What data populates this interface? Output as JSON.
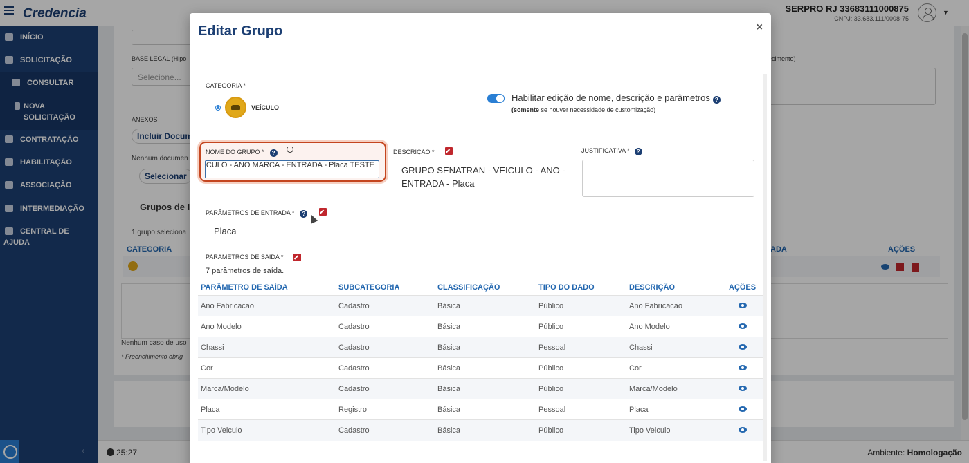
{
  "header": {
    "logo": "Credencia",
    "org_name": "SERPRO RJ 33683111000875",
    "org_cnpj": "CNPJ: 33.683.111/0008-75"
  },
  "sidebar": {
    "items": [
      {
        "label": "INÍCIO",
        "icon": "home-icon"
      },
      {
        "label": "SOLICITAÇÃO",
        "icon": "edit-icon"
      },
      {
        "label": "CONSULTAR",
        "icon": "search-icon"
      },
      {
        "label": "NOVA SOLICITAÇÃO",
        "icon": "file-icon"
      },
      {
        "label": "CONTRATAÇÃO",
        "icon": "handshake-icon"
      },
      {
        "label": "HABILITAÇÃO",
        "icon": "id-card-icon"
      },
      {
        "label": "ASSOCIAÇÃO",
        "icon": "users-icon"
      },
      {
        "label": "INTERMEDIAÇÃO",
        "icon": "user-tie-icon"
      },
      {
        "label": "CENTRAL DE AJUDA",
        "icon": "help-circle-icon"
      }
    ],
    "collapse_glyph": "‹"
  },
  "background_page": {
    "base_legal_label": "BASE LEGAL (Hipó",
    "base_legal_placeholder": "Selecione...",
    "right_label": "ecimento)",
    "anexos_label": "ANEXOS",
    "incluir_btn": "Incluir Docum",
    "nenhum_doc": "Nenhum documen",
    "selecionar_btn": "Selecionar",
    "grupos_title": "Grupos de In",
    "grupo_selecionado": "1 grupo seleciona",
    "col_categoria": "CATEGORIA",
    "col_ada": "ADA",
    "col_acoes": "AÇÕES",
    "nenhum_caso": "Nenhum caso de uso",
    "preenchimento": "* Preenchimento obrig"
  },
  "footer": {
    "timer": "25:27",
    "env_label": "Ambiente:",
    "env_value": "Homologação"
  },
  "modal": {
    "title": "Editar Grupo",
    "close": "×",
    "categoria_label": "CATEGORIA *",
    "categoria_option": "VEÍCULO",
    "toggle_text": "Habilitar edição de nome, descrição e parâmetros",
    "toggle_note_bold": "(somente",
    "toggle_note_rest": " se houver necessidade de customização)",
    "nome_label": "NOME DO GRUPO *",
    "nome_value": "GRUPO SENATRAN - VEICULO - ANO MARCA - ENTRADA - Placa  TESTE",
    "descricao_label": "DESCRIÇÃO *",
    "descricao_value": "GRUPO SENATRAN - VEICULO - ANO - ENTRADA - Placa",
    "justificativa_label": "JUSTIFICATIVA *",
    "param_entrada_label": "PARÂMETROS DE ENTRADA *",
    "param_entrada_value": "Placa",
    "param_saida_label": "PARÂMETROS DE SAÍDA *",
    "param_saida_count": "7 parâmetros de saída.",
    "table": {
      "headers": [
        "Parâmetro de saída",
        "Subcategoria",
        "Classificação",
        "Tipo do dado",
        "Descrição",
        "Ações"
      ],
      "rows": [
        [
          "Ano Fabricacao",
          "Cadastro",
          "Básica",
          "Público",
          "Ano Fabricacao"
        ],
        [
          "Ano Modelo",
          "Cadastro",
          "Básica",
          "Público",
          "Ano Modelo"
        ],
        [
          "Chassi",
          "Cadastro",
          "Básica",
          "Pessoal",
          "Chassi"
        ],
        [
          "Cor",
          "Cadastro",
          "Básica",
          "Público",
          "Cor"
        ],
        [
          "Marca/Modelo",
          "Cadastro",
          "Básica",
          "Público",
          "Marca/Modelo"
        ],
        [
          "Placa",
          "Registro",
          "Básica",
          "Pessoal",
          "Placa"
        ],
        [
          "Tipo Veiculo",
          "Cadastro",
          "Básica",
          "Público",
          "Tipo Veiculo"
        ]
      ]
    }
  }
}
